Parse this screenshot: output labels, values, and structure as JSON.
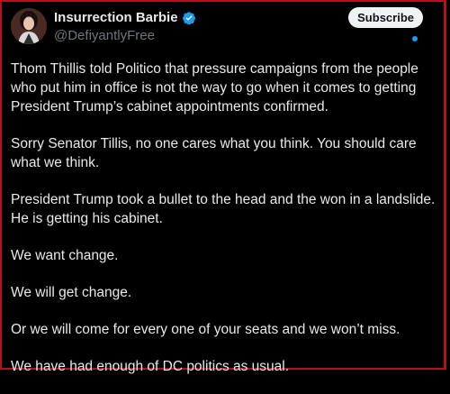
{
  "author": {
    "display_name": "Insurrection Barbie",
    "handle": "@DefiyantlyFree",
    "verified": true,
    "avatar_icon": "profile-photo-avatar"
  },
  "subscribe_label": "Subscribe",
  "colors": {
    "background": "#000000",
    "text": "#e7e9ea",
    "muted": "#71767b",
    "verified": "#1d9bf0",
    "frame": "#b3121b"
  },
  "post": {
    "paragraphs": [
      "Thom Thillis told Politico that pressure campaigns from the people who put him in office is not the way to go when it comes to getting President Trump’s cabinet appointments confirmed.",
      "Sorry Senator Tillis, no one cares what you think. You should care what we think.",
      "President Trump took a bullet to the head and the won in a landslide. He is getting his cabinet.",
      "We want change.",
      "We will get change.",
      "Or we will come for every one of your seats and we won’t miss.",
      "We have had enough of DC politics as usual."
    ]
  }
}
